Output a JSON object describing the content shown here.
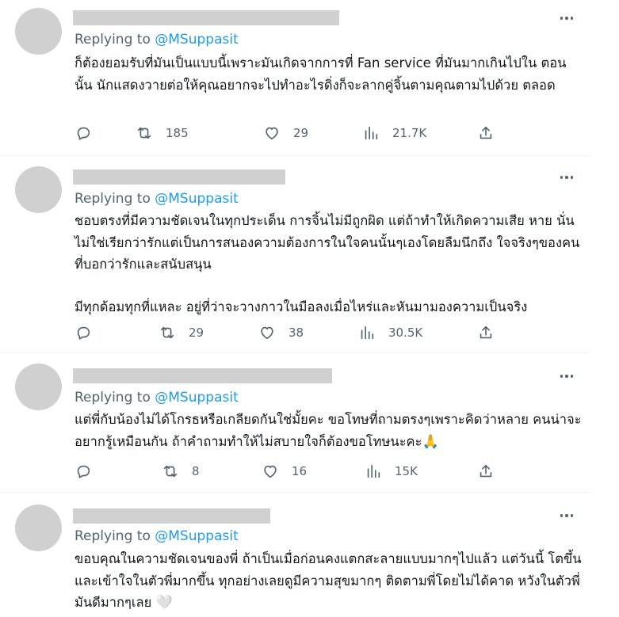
{
  "tweets": [
    {
      "reply_prefix": "Replying to",
      "reply_handle": "@MSuppasit",
      "paragraphs": [
        "ก็ต้องยอมรับที่มันเป็นแบบนี้เพราะมันเกิดจากการที่ Fan service ที่มันมากเกินไปใน ตอนนั้น นักแสดงวายต่อให้คุณอยากจะไปทำอะไรดิ่งก็จะลากคู่จิ้นตามคุณตามไปด้วย ตลอด"
      ],
      "retweets": "185",
      "likes": "29",
      "views": "21.7K"
    },
    {
      "reply_prefix": "Replying to",
      "reply_handle": "@MSuppasit",
      "paragraphs": [
        "ชอบตรงที่มีความชัดเจนในทุกประเด็น การจิ้นไม่มีถูกผิด แต่ถ้าทำให้เกิดความเสีย หาย นั่นไม่ใช่เรียกว่ารักแต่เป็นการสนองความต้องการในใจคนนั้นๆเองโดยลืมนึกถึง ใจจริงๆของคนที่บอกว่ารักและสนับสนุน",
        "มีทุกด้อมทุกที่แหละ อยู่ที่ว่าจะวางกาวในมือลงเมื่อไหร่และหันมามองความเป็นจริง"
      ],
      "retweets": "29",
      "likes": "38",
      "views": "30.5K"
    },
    {
      "reply_prefix": "Replying to",
      "reply_handle": "@MSuppasit",
      "paragraphs": [
        "แต่พี่กับน้องไม่ได้โกรธหรือเกลียดกันใช่มั้ยคะ ขอโทษที่ถามตรงๆเพราะคิดว่าหลาย คนน่าจะอยากรู้เหมือนกัน ถ้าคำถามทำให้ไม่สบายใจก็ต้องขอโทษนะคะ"
      ],
      "emoji": "🙏",
      "retweets": "8",
      "likes": "16",
      "views": "15K"
    },
    {
      "reply_prefix": "Replying to",
      "reply_handle": "@MSuppasit",
      "paragraphs": [
        "ขอบคุณในความชัดเจนของพี่ ถ้าเป็นเมื่อก่อนคงแตกสะลายแบบมากๆไปแล้ว แต่วันนี้ โตขึ้นและเข้าใจในตัวพี่มากขึ้น ทุกอย่างเลยดูมีความสุขมากๆ ติดตามพี่โดยไม่ได้คาด หวังในตัวพี่มันดีมากๆเลย"
      ],
      "emoji": "🤍"
    }
  ]
}
